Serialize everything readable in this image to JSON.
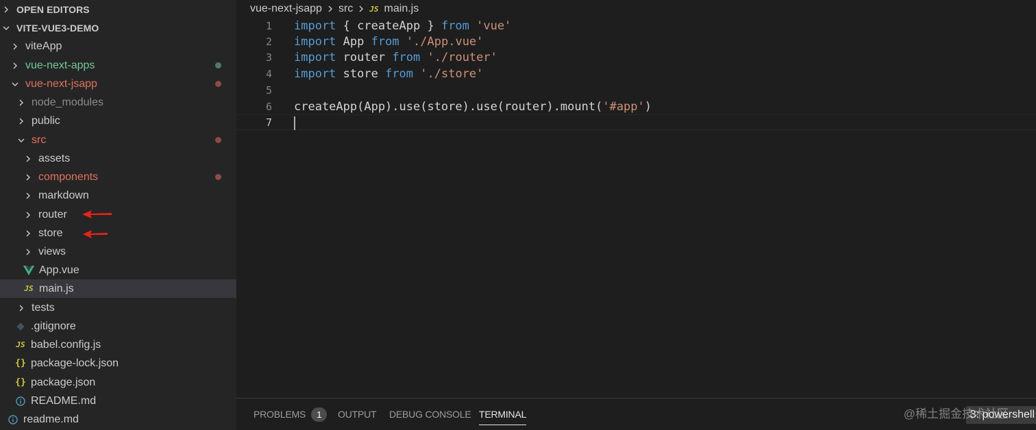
{
  "explorer": {
    "open_editors": "OPEN EDITORS",
    "project": "VITE-VUE3-DEMO",
    "items": [
      {
        "label": "viteApp"
      },
      {
        "label": "vue-next-apps"
      },
      {
        "label": "vue-next-jsapp"
      },
      {
        "label": "node_modules"
      },
      {
        "label": "public"
      },
      {
        "label": "src"
      },
      {
        "label": "assets"
      },
      {
        "label": "components"
      },
      {
        "label": "markdown"
      },
      {
        "label": "router"
      },
      {
        "label": "store"
      },
      {
        "label": "views"
      },
      {
        "label": "App.vue"
      },
      {
        "label": "main.js"
      },
      {
        "label": "tests"
      },
      {
        "label": ".gitignore"
      },
      {
        "label": "babel.config.js"
      },
      {
        "label": "package-lock.json"
      },
      {
        "label": "package.json"
      },
      {
        "label": "README.md"
      },
      {
        "label": "readme.md"
      }
    ]
  },
  "icons": {
    "js": "JS",
    "json": "{}",
    "vue": "vue-icon",
    "git": "git-icon",
    "info": "info-icon"
  },
  "breadcrumb": {
    "folder": "vue-next-jsapp",
    "subfolder": "src",
    "file": "main.js"
  },
  "editor": {
    "line_numbers": [
      "1",
      "2",
      "3",
      "4",
      "5",
      "6",
      "7"
    ],
    "lines": [
      {
        "kw1": "import",
        "t1": " { createApp } ",
        "kw2": "from",
        "s": "'vue'"
      },
      {
        "kw1": "import",
        "t1": " App ",
        "kw2": "from",
        "s": "'./App.vue'"
      },
      {
        "kw1": "import",
        "t1": " router ",
        "kw2": "from",
        "s": "'./router'"
      },
      {
        "kw1": "import",
        "t1": " store ",
        "kw2": "from",
        "s": "'./store'"
      },
      {
        "pre": "createApp(App).use(store).use(router).mount(",
        "s": "'#app'",
        "post": ")"
      }
    ]
  },
  "panel": {
    "tabs": [
      "PROBLEMS",
      "OUTPUT",
      "DEBUG CONSOLE",
      "TERMINAL"
    ],
    "problems_count": "1",
    "terminal_select": "3: powershell",
    "watermark": "@稀土掘金技术社区"
  },
  "colors": {
    "keyword": "#569cd6",
    "string": "#ce9178",
    "modified_red": "#e2725b",
    "untracked_green": "#73c991",
    "annotation_arrow": "#e8231a"
  }
}
